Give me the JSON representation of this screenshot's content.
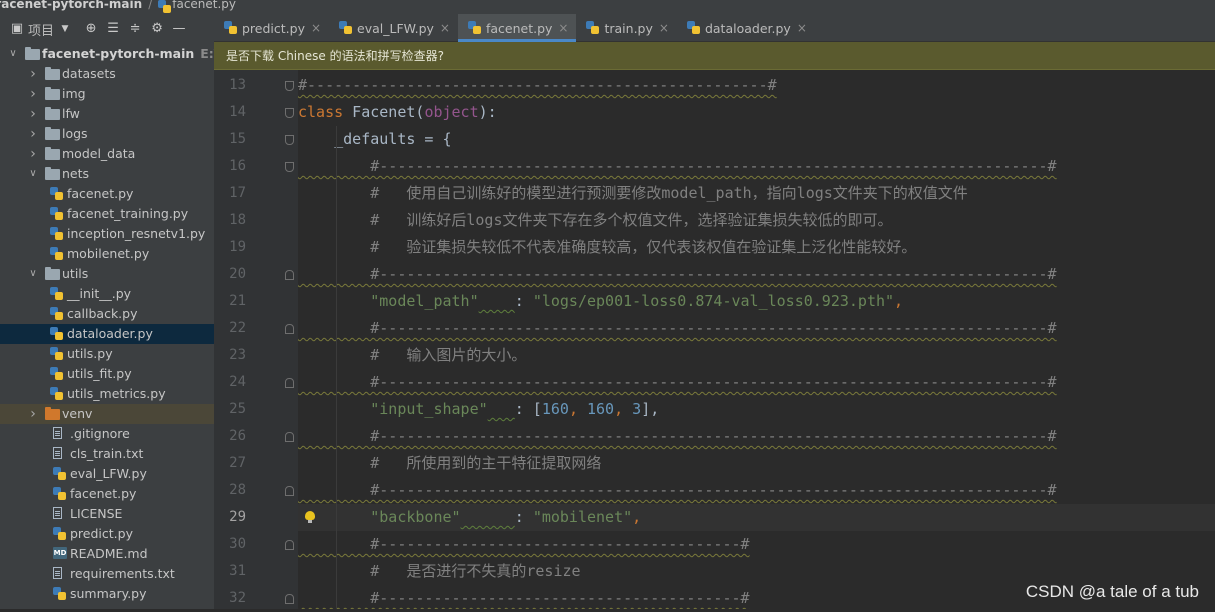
{
  "breadcrumb": {
    "project": "facenet-pytorch-main",
    "file": "facenet.py"
  },
  "panel": {
    "title": "项目"
  },
  "tree": [
    {
      "label": "facenet-pytorch-main",
      "path": "E:\\facenet",
      "type": "root",
      "indent": 0,
      "arrow": "open"
    },
    {
      "label": "datasets",
      "type": "folder",
      "indent": 1,
      "arrow": "closed"
    },
    {
      "label": "img",
      "type": "folder",
      "indent": 1,
      "arrow": "closed"
    },
    {
      "label": "lfw",
      "type": "folder",
      "indent": 1,
      "arrow": "closed"
    },
    {
      "label": "logs",
      "type": "folder",
      "indent": 1,
      "arrow": "closed"
    },
    {
      "label": "model_data",
      "type": "folder",
      "indent": 1,
      "arrow": "closed"
    },
    {
      "label": "nets",
      "type": "folder",
      "indent": 1,
      "arrow": "open"
    },
    {
      "label": "facenet.py",
      "type": "py",
      "indent": 2
    },
    {
      "label": "facenet_training.py",
      "type": "py",
      "indent": 2
    },
    {
      "label": "inception_resnetv1.py",
      "type": "py",
      "indent": 2
    },
    {
      "label": "mobilenet.py",
      "type": "py",
      "indent": 2
    },
    {
      "label": "utils",
      "type": "folder",
      "indent": 1,
      "arrow": "open"
    },
    {
      "label": "__init__.py",
      "type": "py",
      "indent": 2
    },
    {
      "label": "callback.py",
      "type": "py",
      "indent": 2
    },
    {
      "label": "dataloader.py",
      "type": "py",
      "indent": 2,
      "selected": true
    },
    {
      "label": "utils.py",
      "type": "py",
      "indent": 2
    },
    {
      "label": "utils_fit.py",
      "type": "py",
      "indent": 2
    },
    {
      "label": "utils_metrics.py",
      "type": "py",
      "indent": 2
    },
    {
      "label": "venv",
      "type": "folder-orange",
      "indent": 1,
      "arrow": "closed",
      "highlight": true
    },
    {
      "label": ".gitignore",
      "type": "txt",
      "indent": 1
    },
    {
      "label": "cls_train.txt",
      "type": "txt",
      "indent": 1
    },
    {
      "label": "eval_LFW.py",
      "type": "py",
      "indent": 1
    },
    {
      "label": "facenet.py",
      "type": "py",
      "indent": 1
    },
    {
      "label": "LICENSE",
      "type": "txt",
      "indent": 1
    },
    {
      "label": "predict.py",
      "type": "py",
      "indent": 1
    },
    {
      "label": "README.md",
      "type": "md",
      "indent": 1
    },
    {
      "label": "requirements.txt",
      "type": "txt",
      "indent": 1
    },
    {
      "label": "summary.py",
      "type": "py",
      "indent": 1
    }
  ],
  "tabs": [
    {
      "label": "predict.py",
      "active": false
    },
    {
      "label": "eval_LFW.py",
      "active": false
    },
    {
      "label": "facenet.py",
      "active": true
    },
    {
      "label": "train.py",
      "active": false
    },
    {
      "label": "dataloader.py",
      "active": false
    }
  ],
  "banner": {
    "text": "是否下载 Chinese 的语法和拼写检查器?"
  },
  "editor": {
    "current_line": 29,
    "lines": [
      {
        "n": 13,
        "tokens": [
          {
            "t": "#---------------------------------------------------#",
            "c": "cm"
          }
        ]
      },
      {
        "n": 14,
        "tokens": [
          {
            "t": "class",
            "c": "kw"
          },
          {
            "t": " Facenet(",
            "c": ""
          },
          {
            "t": "object",
            "c": "self"
          },
          {
            "t": "):",
            "c": ""
          }
        ]
      },
      {
        "n": 15,
        "tokens": [
          {
            "t": "    _defaults = {",
            "c": ""
          }
        ]
      },
      {
        "n": 16,
        "tokens": [
          {
            "t": "        #--------------------------------------------------------------------------#",
            "c": "cm"
          }
        ]
      },
      {
        "n": 17,
        "tokens": [
          {
            "t": "        #   使用自己训练好的模型进行预测要修改model_path，指向logs文件夹下的权值文件",
            "c": "cm"
          }
        ]
      },
      {
        "n": 18,
        "tokens": [
          {
            "t": "        #   训练好后logs文件夹下存在多个权值文件，选择验证集损失较低的即可。",
            "c": "cm"
          }
        ]
      },
      {
        "n": 19,
        "tokens": [
          {
            "t": "        #   验证集损失较低不代表准确度较高，仅代表该权值在验证集上泛化性能较好。",
            "c": "cm"
          }
        ]
      },
      {
        "n": 20,
        "tokens": [
          {
            "t": "        #--------------------------------------------------------------------------#",
            "c": "cm"
          }
        ]
      },
      {
        "n": 21,
        "tokens": [
          {
            "t": "        ",
            "c": ""
          },
          {
            "t": "\"model_path\"",
            "c": "str"
          },
          {
            "t": "    ",
            "c": "wv"
          },
          {
            "t": ": ",
            "c": ""
          },
          {
            "t": "\"logs/ep001-loss0.874-val_loss0.923.pth\"",
            "c": "str"
          },
          {
            "t": ",",
            "c": "kw"
          }
        ]
      },
      {
        "n": 22,
        "tokens": [
          {
            "t": "        #--------------------------------------------------------------------------#",
            "c": "cm"
          }
        ]
      },
      {
        "n": 23,
        "tokens": [
          {
            "t": "        #   输入图片的大小。",
            "c": "cm"
          }
        ]
      },
      {
        "n": 24,
        "tokens": [
          {
            "t": "        #--------------------------------------------------------------------------#",
            "c": "cm"
          }
        ]
      },
      {
        "n": 25,
        "tokens": [
          {
            "t": "        ",
            "c": ""
          },
          {
            "t": "\"input_shape\"",
            "c": "str"
          },
          {
            "t": "   ",
            "c": "wv"
          },
          {
            "t": ": [",
            "c": ""
          },
          {
            "t": "160",
            "c": "num"
          },
          {
            "t": ", ",
            "c": "kw"
          },
          {
            "t": "160",
            "c": "num"
          },
          {
            "t": ", ",
            "c": "kw"
          },
          {
            "t": "3",
            "c": "num"
          },
          {
            "t": "],",
            "c": ""
          }
        ]
      },
      {
        "n": 26,
        "tokens": [
          {
            "t": "        #--------------------------------------------------------------------------#",
            "c": "cm"
          }
        ]
      },
      {
        "n": 27,
        "tokens": [
          {
            "t": "        #   所使用到的主干特征提取网络",
            "c": "cm"
          }
        ]
      },
      {
        "n": 28,
        "tokens": [
          {
            "t": "        #--------------------------------------------------------------------------#",
            "c": "cm"
          }
        ]
      },
      {
        "n": 29,
        "tokens": [
          {
            "t": "        ",
            "c": ""
          },
          {
            "t": "\"backbone\"",
            "c": "str"
          },
          {
            "t": "      ",
            "c": "wv"
          },
          {
            "t": ": ",
            "c": ""
          },
          {
            "t": "\"mobilenet\"",
            "c": "str"
          },
          {
            "t": ",",
            "c": "kw"
          }
        ]
      },
      {
        "n": 30,
        "tokens": [
          {
            "t": "        #----------------------------------------#",
            "c": "cm"
          }
        ]
      },
      {
        "n": 31,
        "tokens": [
          {
            "t": "        #   是否进行不失真的resize",
            "c": "cm"
          }
        ]
      },
      {
        "n": 32,
        "tokens": [
          {
            "t": "        #----------------------------------------#",
            "c": "cm"
          }
        ]
      }
    ]
  },
  "watermark": "CSDN @a tale of a tub"
}
